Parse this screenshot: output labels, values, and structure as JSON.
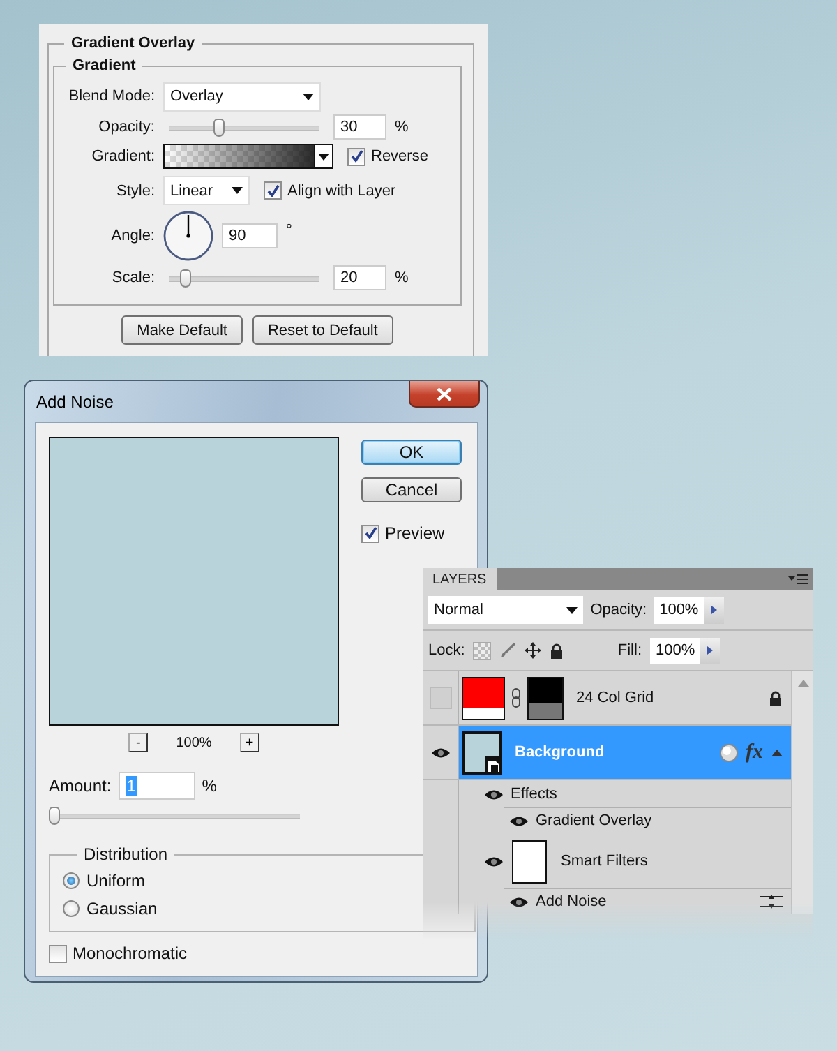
{
  "gradient_overlay": {
    "title": "Gradient Overlay",
    "group_title": "Gradient",
    "blend_mode": {
      "label": "Blend Mode:",
      "value": "Overlay"
    },
    "opacity": {
      "label": "Opacity:",
      "level": 0.3,
      "value": "30",
      "unit": "%"
    },
    "gradient": {
      "label": "Gradient:",
      "reverse": {
        "label": "Reverse",
        "checked": true
      }
    },
    "style": {
      "label": "Style:",
      "value": "Linear",
      "align": {
        "label": "Align with Layer",
        "checked": true
      }
    },
    "angle": {
      "label": "Angle:",
      "value": "90",
      "unit": "°"
    },
    "scale": {
      "label": "Scale:",
      "level": 0.07,
      "value": "20",
      "unit": "%"
    },
    "buttons": [
      "Make Default",
      "Reset to Default"
    ]
  },
  "add_noise": {
    "title": "Add Noise",
    "buttons": [
      {
        "label": "OK",
        "default": true
      },
      {
        "label": "Cancel",
        "default": false
      }
    ],
    "preview": {
      "label": "Preview",
      "checked": true
    },
    "zoom": {
      "minus": "-",
      "value": "100%",
      "plus": "+"
    },
    "amount": {
      "label": "Amount:",
      "value": "1",
      "unit": "%",
      "level": 0.0
    },
    "distribution": {
      "title": "Distribution",
      "options": [
        {
          "label": "Uniform",
          "selected": true
        },
        {
          "label": "Gaussian",
          "selected": false
        }
      ]
    },
    "monochromatic": {
      "label": "Monochromatic",
      "checked": false
    }
  },
  "layers": {
    "title": "LAYERS",
    "blend_mode": "Normal",
    "opacity": {
      "label": "Opacity:",
      "value": "100%"
    },
    "lock_label": "Lock:",
    "fill": {
      "label": "Fill:",
      "value": "100%"
    },
    "items": [
      {
        "kind": "masked",
        "name": "24 Col Grid",
        "visible": false,
        "selected": false,
        "locked": true
      },
      {
        "kind": "smart-object",
        "name": "Background",
        "visible": true,
        "selected": true,
        "locked": false,
        "fx": "fx",
        "expanded": true,
        "children": [
          {
            "kind": "effects",
            "name": "Effects",
            "visible": true,
            "children": [
              {
                "kind": "effect",
                "name": "Gradient Overlay",
                "visible": true
              }
            ]
          },
          {
            "kind": "smart-filters",
            "name": "Smart Filters",
            "visible": true,
            "children": [
              {
                "kind": "filter",
                "name": "Add Noise",
                "visible": true
              }
            ]
          }
        ]
      }
    ]
  }
}
